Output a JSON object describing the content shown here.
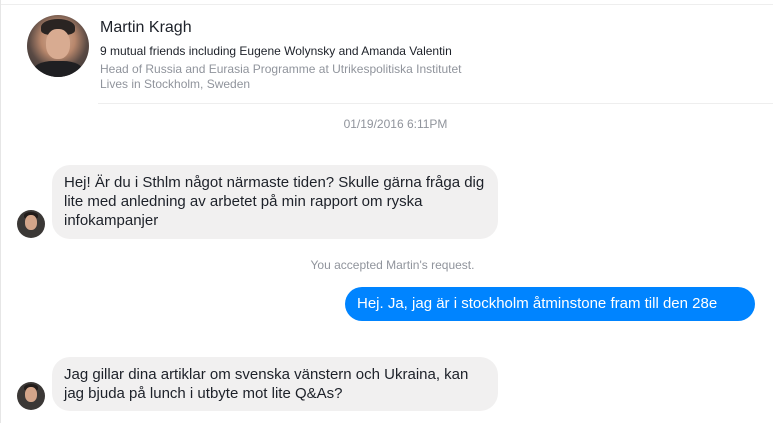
{
  "profile": {
    "name": "Martin Kragh",
    "mutual": "9 mutual friends including Eugene Wolynsky and Amanda Valentin",
    "work": "Head of Russia and Eurasia Programme at Utrikespolitiska Institutet",
    "lives": "Lives in Stockholm, Sweden"
  },
  "thread": {
    "timestamp": "01/19/2016 6:11PM",
    "messages": [
      {
        "text": "Hej! Är du i Sthlm något närmaste tiden? Skulle gärna fråga dig lite med anledning av arbetet på min rapport om ryska infokampanjer"
      },
      {
        "text": "Hej. Ja, jag är  i stockholm åtminstone fram till den 28e"
      },
      {
        "text": "Jag gillar dina artiklar om svenska vänstern och Ukraina, kan jag bjuda på lunch i utbyte mot lite Q&As?"
      }
    ],
    "system_note": "You accepted Martin's request."
  },
  "colors": {
    "outgoing_bubble": "#0084ff",
    "incoming_bubble": "#f1f0f0",
    "muted_text": "#90949c"
  }
}
